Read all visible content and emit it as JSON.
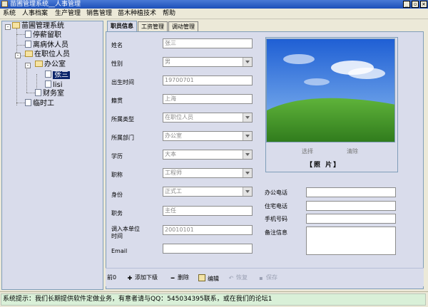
{
  "window": {
    "title": "苗圃管理系统__人事管理",
    "buttons": {
      "minimize": "_",
      "restore": "▫",
      "close": "✕"
    }
  },
  "menu": [
    "系统",
    "人事档案",
    "生产管理",
    "销售管理",
    "苗木种植技术",
    "帮助"
  ],
  "tree": {
    "root": "苗圃管理系统",
    "nodes": [
      "停薪留职",
      "离病休人员",
      "在职位人员",
      "办公室",
      "张三",
      "lisi",
      "财务室",
      "临时工"
    ]
  },
  "tabs": [
    "职员信息",
    "工资管理",
    "调动管理"
  ],
  "form": {
    "name_label": "姓名",
    "name_value": "张三",
    "gender_label": "性别",
    "gender_value": "男",
    "birth_label": "出生时间",
    "birth_value": "19700701",
    "origin_label": "籍贯",
    "origin_value": "上海",
    "type_label": "所属类型",
    "type_value": "在职位人员",
    "dept_label": "所属部门",
    "dept_value": "办公室",
    "edu_label": "学历",
    "edu_value": "大本",
    "title_label": "职称",
    "title_value": "工程师",
    "status_label": "身份",
    "status_value": "正式工",
    "job_label": "职务",
    "job_value": "主任",
    "join_label_1": "调入本单位",
    "join_label_2": "时间",
    "join_value": "20010101",
    "email_label": "Email",
    "email_value": ""
  },
  "photo": {
    "select": "选择",
    "clear": "清除",
    "caption": "【照 片】"
  },
  "contact": {
    "office_phone_label": "办公电话",
    "home_phone_label": "住宅电话",
    "mobile_label": "手机号码",
    "notes_label": "备注信息"
  },
  "toolbar": {
    "prev_label": "前0",
    "add_label": "添加下级",
    "delete_label": "删除",
    "edit_label": "编辑",
    "restore_label": "恢复",
    "save_label": "保存"
  },
  "status": "系统提示：我们长期提供软件定做业务，有意者请与QQ：545034395联系，或在我们的论坛1"
}
